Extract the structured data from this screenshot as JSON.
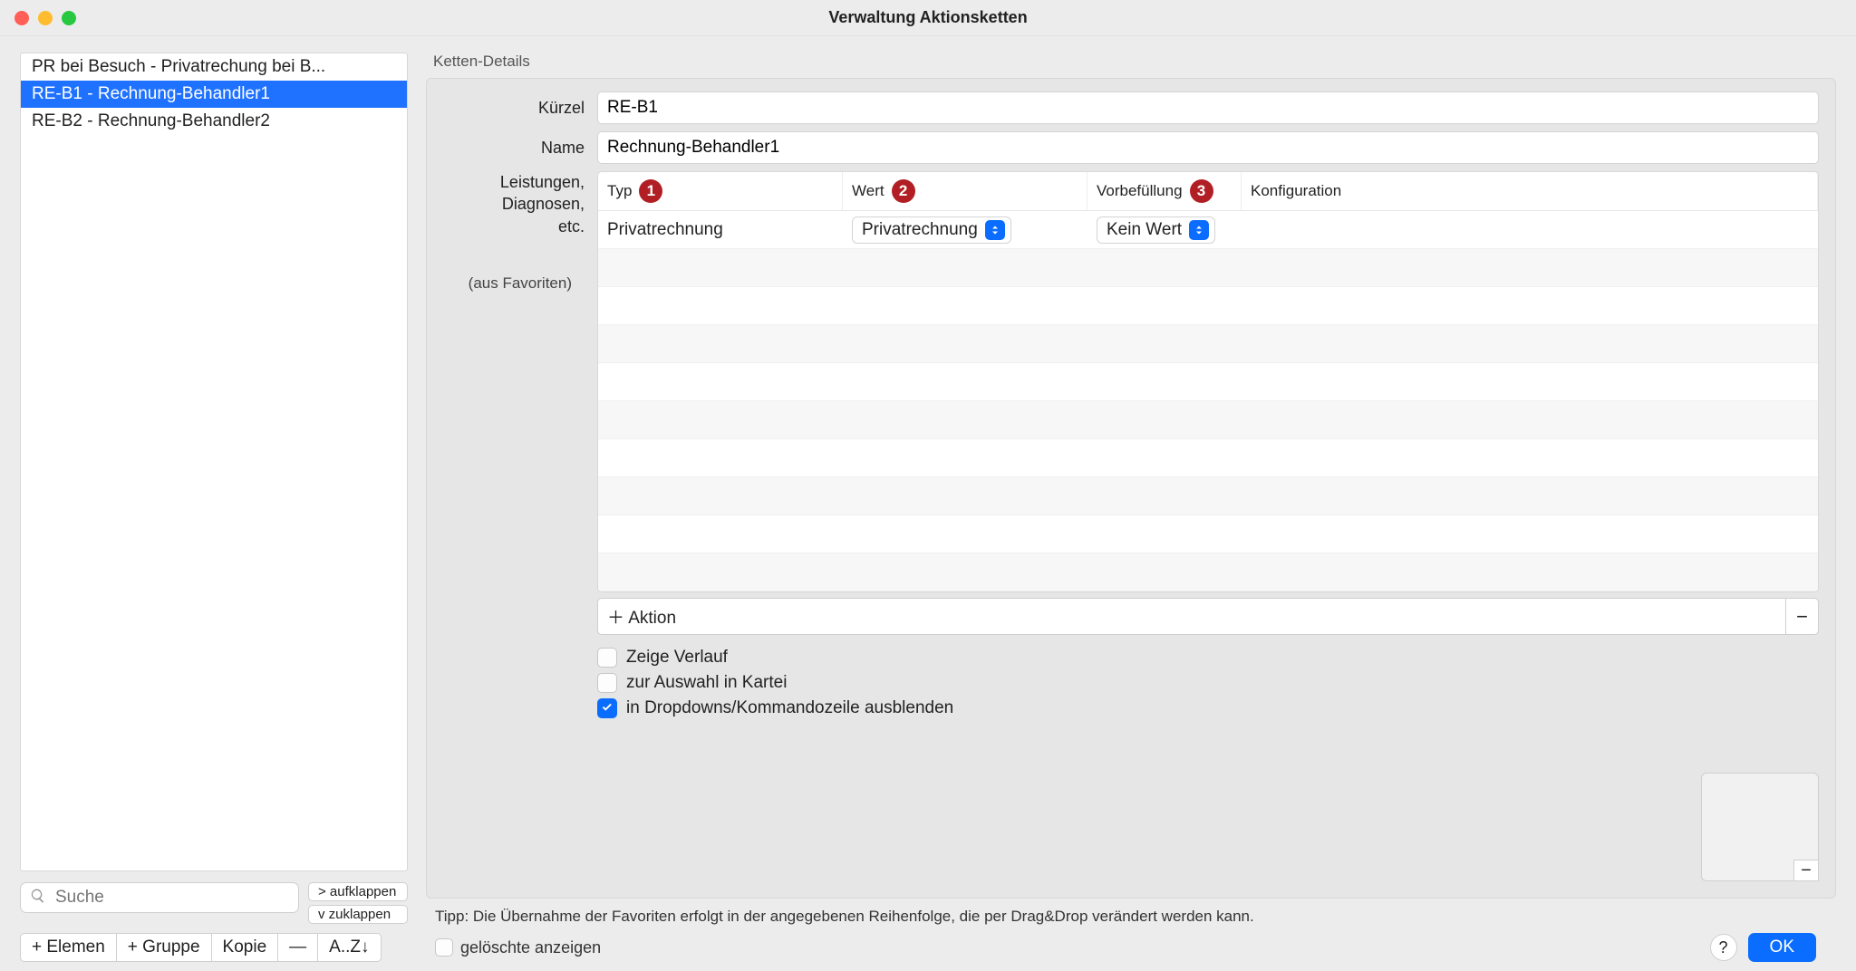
{
  "window": {
    "title": "Verwaltung Aktionsketten"
  },
  "sidebar": {
    "items": [
      {
        "label": "PR bei Besuch - Privatrechung bei B...",
        "selected": false
      },
      {
        "label": "RE-B1 - Rechnung-Behandler1",
        "selected": true
      },
      {
        "label": "RE-B2 - Rechnung-Behandler2",
        "selected": false
      }
    ],
    "search_placeholder": "Suche",
    "expand_label": "> aufklappen",
    "collapse_label": "v  zuklappen",
    "toolbar": {
      "add_element": "+ Elemen",
      "add_group": "+ Gruppe",
      "copy": "Kopie",
      "remove": "—",
      "sort": "A..Z↓"
    }
  },
  "details": {
    "section_title": "Ketten-Details",
    "kuerzel_label": "Kürzel",
    "kuerzel_value": "RE-B1",
    "name_label": "Name",
    "name_value": "Rechnung-Behandler1",
    "table_label_l1": "Leistungen,",
    "table_label_l2": "Diagnosen,",
    "table_label_l3": "etc.",
    "favoriten_note": "(aus Favoriten)",
    "columns": {
      "typ": "Typ",
      "wert": "Wert",
      "vorbefuellung": "Vorbefüllung",
      "konfiguration": "Konfiguration"
    },
    "badges": {
      "typ": "1",
      "wert": "2",
      "vor": "3"
    },
    "rows": [
      {
        "typ": "Privatrechnung",
        "wert": "Privatrechnung",
        "vor": "Kein Wert"
      }
    ],
    "add_action_label": "＋ Aktion",
    "checkboxes": {
      "zeige_verlauf": {
        "label": "Zeige Verlauf",
        "checked": false
      },
      "zur_auswahl": {
        "label": "zur Auswahl in Kartei",
        "checked": false
      },
      "in_dropdowns": {
        "label": "in Dropdowns/Kommandozeile ausblenden",
        "checked": true
      }
    }
  },
  "footer": {
    "tip": "Tipp: Die Übernahme der Favoriten erfolgt in der angegebenen Reihenfolge, die per Drag&Drop verändert werden kann.",
    "show_deleted_label": "gelöschte anzeigen",
    "ok_label": "OK"
  }
}
